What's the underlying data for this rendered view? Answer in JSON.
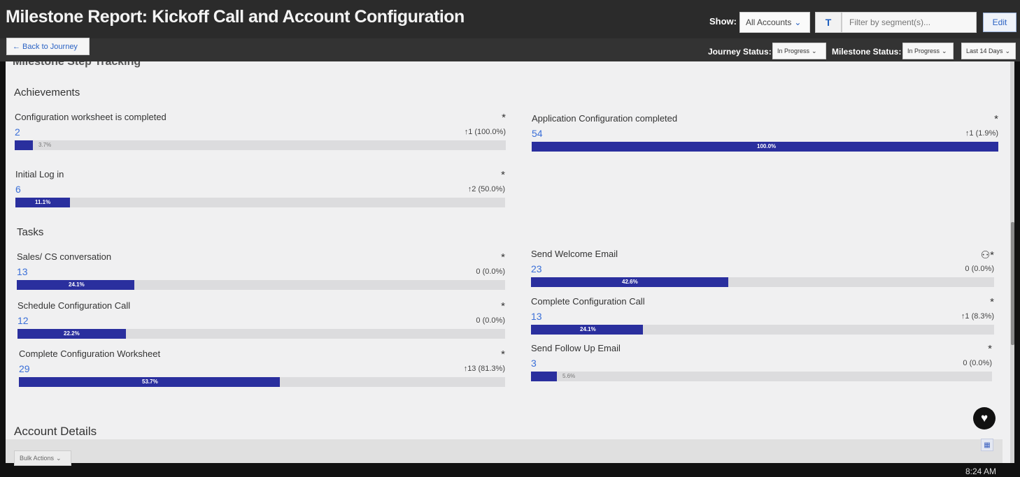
{
  "header": {
    "title": "Milestone Report: Kickoff Call and Account Configuration",
    "show_label": "Show:",
    "accounts_select": "All Accounts",
    "filter_icon": "T",
    "filter_placeholder": "Filter by segment(s)...",
    "edit_label": "Edit"
  },
  "subheader": {
    "back_label": "← Back to Journey",
    "journey_status_label": "Journey Status:",
    "journey_status_value": "In Progress",
    "milestone_status_label": "Milestone Status:",
    "milestone_status_value": "In Progress",
    "date_range": "Last 14 Days"
  },
  "clipped_heading": "Milestone Step Tracking",
  "achievements": {
    "title": "Achievements",
    "items": [
      {
        "label": "Configuration worksheet is completed",
        "value": "2",
        "change": "↑1 (100.0%)",
        "percent_label": "3.7%",
        "percent": 3.7,
        "icon": "*"
      },
      {
        "label": "Application Configuration completed",
        "value": "54",
        "change": "↑1 (1.9%)",
        "percent_label": "100.0%",
        "percent": 100,
        "icon": "*"
      },
      {
        "label": "Initial Log in",
        "value": "6",
        "change": "↑2 (50.0%)",
        "percent_label": "11.1%",
        "percent": 11.1,
        "icon": "*"
      }
    ]
  },
  "tasks": {
    "title": "Tasks",
    "items": [
      {
        "label": "Sales/ CS conversation",
        "value": "13",
        "change": "0 (0.0%)",
        "percent_label": "24.1%",
        "percent": 24.1,
        "icon": "*"
      },
      {
        "label": "Send Welcome Email",
        "value": "23",
        "change": "0 (0.0%)",
        "percent_label": "42.6%",
        "percent": 42.6,
        "icon": "⚇*"
      },
      {
        "label": "Schedule Configuration Call",
        "value": "12",
        "change": "0 (0.0%)",
        "percent_label": "22.2%",
        "percent": 22.2,
        "icon": "*"
      },
      {
        "label": "Complete Configuration Call",
        "value": "13",
        "change": "↑1 (8.3%)",
        "percent_label": "24.1%",
        "percent": 24.1,
        "icon": "*"
      },
      {
        "label": "Complete Configuration Worksheet",
        "value": "29",
        "change": "↑13 (81.3%)",
        "percent_label": "53.7%",
        "percent": 53.7,
        "icon": "*"
      },
      {
        "label": "Send Follow Up Email",
        "value": "3",
        "change": "0 (0.0%)",
        "percent_label": "5.6%",
        "percent": 5.6,
        "icon": "*"
      }
    ]
  },
  "account_details": {
    "title": "Account Details",
    "bulk_actions": "Bulk Actions"
  },
  "taskbar": {
    "time": "8:24 AM"
  },
  "colors": {
    "bar_fill": "#2a2f9e",
    "value_link": "#3a6fd8",
    "header_bg": "#2b2b2b"
  }
}
